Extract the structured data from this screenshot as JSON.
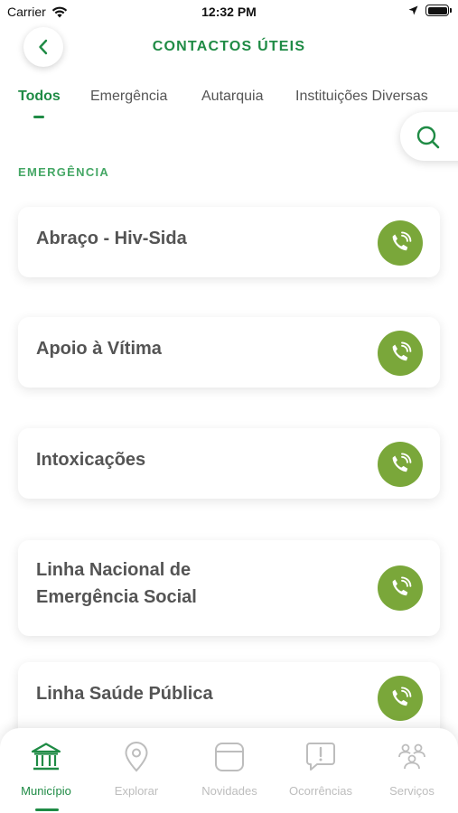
{
  "status_bar": {
    "carrier": "Carrier",
    "time": "12:32 PM"
  },
  "header": {
    "title": "CONTACTOS ÚTEIS",
    "back_icon": "chevron-left-icon"
  },
  "tabs": [
    {
      "label": "Todos",
      "active": true
    },
    {
      "label": "Emergência",
      "active": false
    },
    {
      "label": "Autarquia",
      "active": false
    },
    {
      "label": "Instituições Diversas",
      "active": false
    }
  ],
  "search": {
    "icon": "search-icon"
  },
  "section": {
    "title": "EMERGÊNCIA"
  },
  "contacts": [
    {
      "name": "Abraço - Hiv-Sida",
      "icon": "phone-icon"
    },
    {
      "name": "Apoio à Vítima",
      "icon": "phone-icon"
    },
    {
      "name": "Intoxicações",
      "icon": "phone-icon"
    },
    {
      "name_lines": [
        "Linha Nacional de",
        "Emergência Social"
      ],
      "icon": "phone-icon"
    },
    {
      "name": "Linha Saúde Pública",
      "icon": "phone-icon"
    }
  ],
  "bottom_nav": [
    {
      "label": "Município",
      "icon": "bank-icon",
      "active": true
    },
    {
      "label": "Explorar",
      "icon": "location-pin-icon",
      "active": false
    },
    {
      "label": "Novidades",
      "icon": "calendar-icon",
      "active": false
    },
    {
      "label": "Ocorrências",
      "icon": "alert-message-icon",
      "active": false
    },
    {
      "label": "Serviços",
      "icon": "services-icon",
      "active": false
    }
  ],
  "colors": {
    "primary": "#1f8b45",
    "call_button": "#7aa73a",
    "section": "#45a765",
    "inactive": "#bdbdbd"
  }
}
